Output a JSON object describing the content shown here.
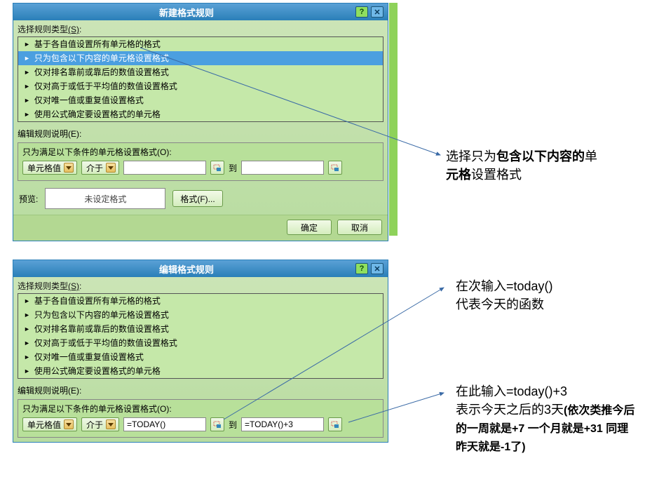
{
  "dialog1": {
    "title": "新建格式规则",
    "sectionRuleType": "选择规则类型",
    "sectionRuleTypeHotkey": "(S)",
    "rules": [
      "基于各自值设置所有单元格的格式",
      "只为包含以下内容的单元格设置格式",
      "仅对排名靠前或靠后的数值设置格式",
      "仅对高于或低于平均值的数值设置格式",
      "仅对唯一值或重复值设置格式",
      "使用公式确定要设置格式的单元格"
    ],
    "selectedRuleIndex": 1,
    "editDesc": "编辑规则说明",
    "editDescHotkey": "(E)",
    "condLabel": "只为满足以下条件的单元格设置格式",
    "condHotkey": "(O)",
    "dd1": "单元格值",
    "dd2": "介于",
    "input1": "",
    "betweenLabel": "到",
    "input2": "",
    "previewLabel": "预览:",
    "previewText": "未设定格式",
    "formatBtn": "格式(F)...",
    "ok": "确定",
    "cancel": "取消"
  },
  "dialog2": {
    "title": "编辑格式规则",
    "sectionRuleType": "选择规则类型",
    "sectionRuleTypeHotkey": "(S)",
    "rules": [
      "基于各自值设置所有单元格的格式",
      "只为包含以下内容的单元格设置格式",
      "仅对排名靠前或靠后的数值设置格式",
      "仅对高于或低于平均值的数值设置格式",
      "仅对唯一值或重复值设置格式",
      "使用公式确定要设置格式的单元格"
    ],
    "selectedRuleIndex": -1,
    "editDesc": "编辑规则说明",
    "editDescHotkey": "(E)",
    "condLabel": "只为满足以下条件的单元格设置格式",
    "condHotkey": "(O)",
    "dd1": "单元格值",
    "dd2": "介于",
    "input1": "=TODAY()",
    "betweenLabel": "到",
    "input2": "=TODAY()+3"
  },
  "annot1_line1_a": "选择只为",
  "annot1_line1_b": "包含以下内容的",
  "annot1_line1_c": "单",
  "annot1_line2_a": "元格",
  "annot1_line2_b": "设置格式",
  "annot2_line1": "在次输入=today()",
  "annot2_line2": "代表今天的函数",
  "annot3_line1": "在此输入=today()+3",
  "annot3_line2_a": "表示今天之后的3天",
  "annot3_line2_b": "(依次类推今后的一周就是+7   一个月就是+31    同理  昨天就是-1了)"
}
